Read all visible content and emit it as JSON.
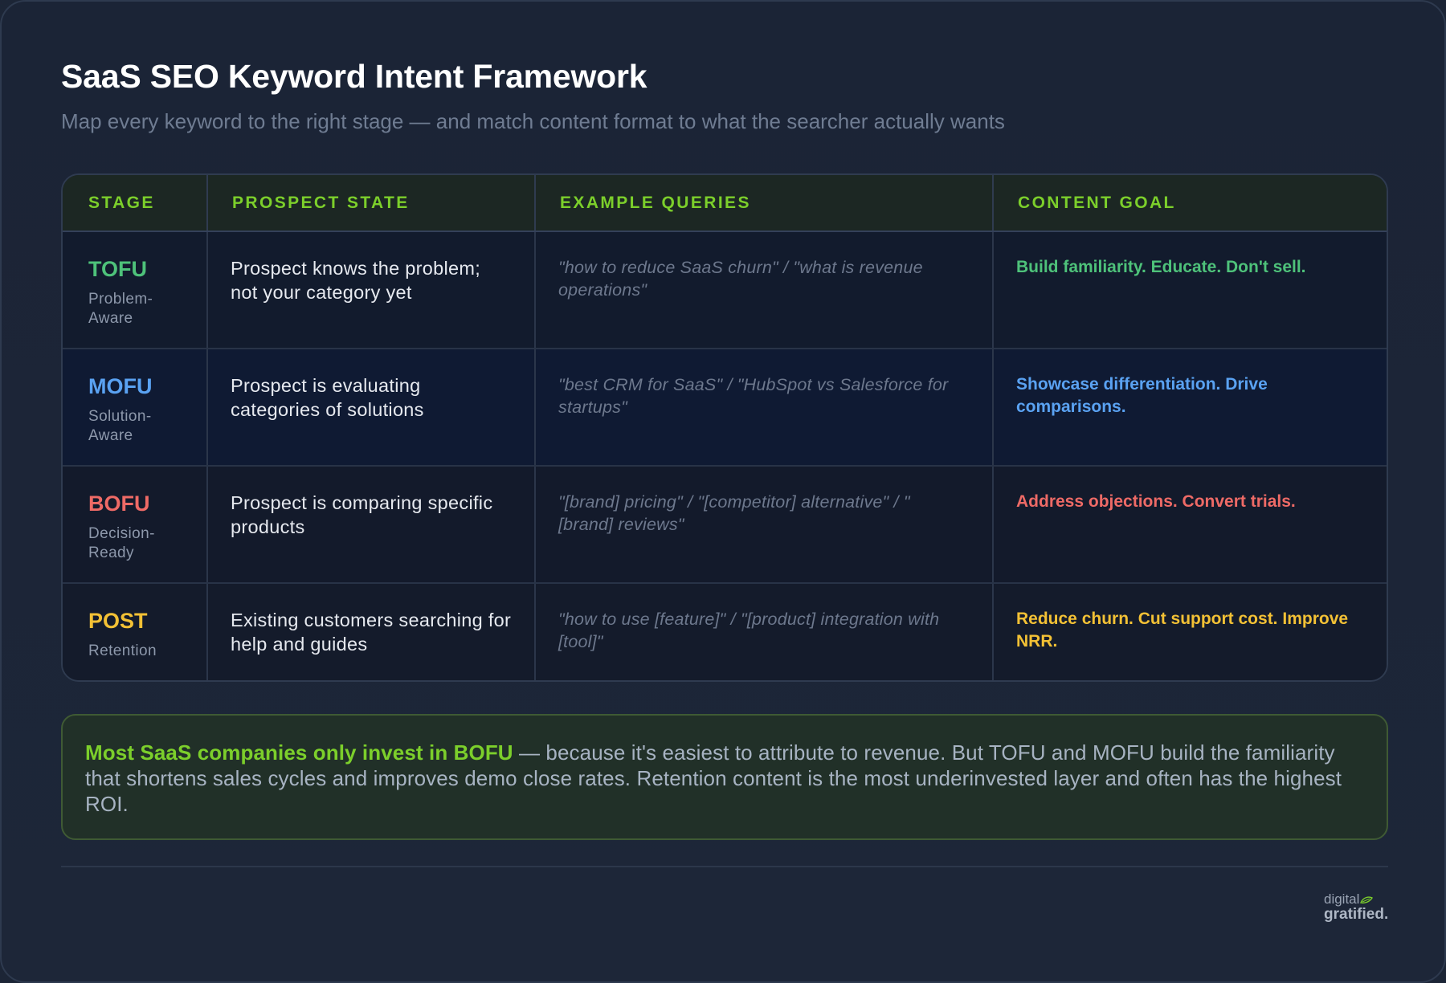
{
  "header": {
    "title": "SaaS SEO Keyword Intent Framework",
    "subtitle": "Map every keyword to the right stage — and match content format to what the searcher actually wants"
  },
  "table": {
    "columns": [
      "STAGE",
      "PROSPECT STATE",
      "EXAMPLE QUERIES",
      "CONTENT GOAL"
    ],
    "rows": [
      {
        "stage": "TOFU",
        "stage_sub": "Problem-Aware",
        "state": "Prospect knows the problem; not your category yet",
        "queries": "\"how to reduce SaaS churn\" / \"what is revenue operations\"",
        "goal": "Build familiarity. Educate. Don't sell.",
        "color": "#4ec27a"
      },
      {
        "stage": "MOFU",
        "stage_sub": "Solution-Aware",
        "state": "Prospect is evaluating categories of solutions",
        "queries": "\"best CRM for SaaS\" / \"HubSpot vs Salesforce for startups\"",
        "goal": "Showcase differentiation. Drive comparisons.",
        "color": "#5aa2f2"
      },
      {
        "stage": "BOFU",
        "stage_sub": "Decision-Ready",
        "state": "Prospect is comparing specific products",
        "queries": "\"[brand] pricing\" / \"[competitor] alternative\" / \" [brand] reviews\"",
        "goal": "Address objections. Convert trials.",
        "color": "#ee6a66"
      },
      {
        "stage": "POST",
        "stage_sub": "Retention",
        "state": "Existing customers searching for help and guides",
        "queries": "\"how to use [feature]\" / \"[product] integration with [tool]\"",
        "goal": "Reduce churn. Cut support cost. Improve NRR.",
        "color": "#f3c135"
      }
    ]
  },
  "callout": {
    "lead": "Most SaaS companies only invest in BOFU",
    "body": " — because it's easiest to attribute to revenue. But TOFU and MOFU build the familiarity that shortens sales cycles and improves demo close rates. Retention content is the most underinvested layer and often has the highest ROI."
  },
  "logo": {
    "line1": "digital",
    "line2": "gratified."
  },
  "colors": {
    "accent": "#7ccf2b",
    "background": "#1c2536"
  },
  "icons": {
    "logo_leaf": "leaf-icon"
  }
}
